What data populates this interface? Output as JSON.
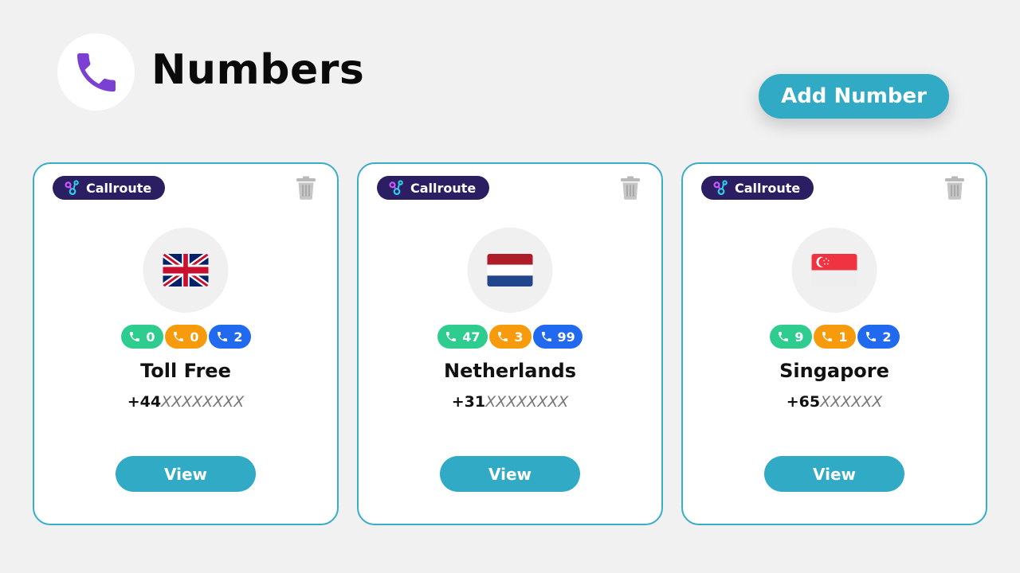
{
  "header": {
    "title": "Numbers",
    "icon": "phone-icon",
    "icon_color": "#7b3fd4"
  },
  "actions": {
    "add_number_label": "Add Number"
  },
  "colors": {
    "accent": "#31aac6",
    "badge_bg": "#2b1e63",
    "pill_green": "#2ecc8f",
    "pill_orange": "#f79a0c",
    "pill_blue": "#2169ee"
  },
  "cards": [
    {
      "provider": "Callroute",
      "flag": "united-kingdom-flag",
      "counts": {
        "green": "0",
        "orange": "0",
        "blue": "2"
      },
      "name": "Toll Free",
      "prefix": "+44",
      "mask": "XXXXXXXX",
      "view_label": "View"
    },
    {
      "provider": "Callroute",
      "flag": "netherlands-flag",
      "counts": {
        "green": "47",
        "orange": "3",
        "blue": "99"
      },
      "name": "Netherlands",
      "prefix": "+31",
      "mask": "XXXXXXXX",
      "view_label": "View"
    },
    {
      "provider": "Callroute",
      "flag": "singapore-flag",
      "counts": {
        "green": "9",
        "orange": "1",
        "blue": "2"
      },
      "name": "Singapore",
      "prefix": "+65",
      "mask": "XXXXXX",
      "view_label": "View"
    }
  ]
}
